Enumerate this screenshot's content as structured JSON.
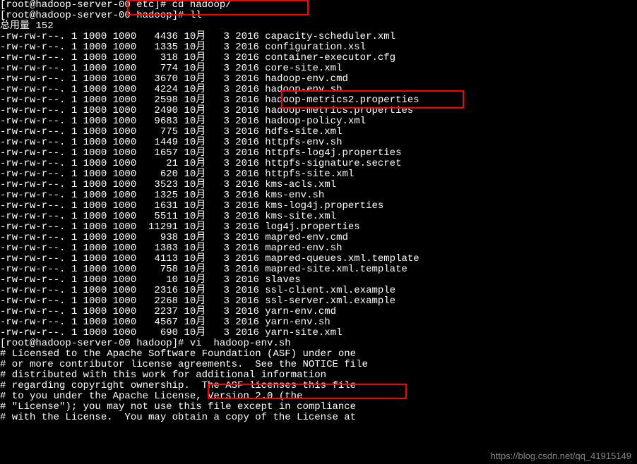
{
  "prompt1": "[root@hadoop-server-00 etc]# ",
  "cmd1": "cd hadoop/",
  "prompt2": "[root@hadoop-server-00 hadoop]# ",
  "cmd2": "ll",
  "total": "总用量 152",
  "files": [
    {
      "perm": "-rw-rw-r--.",
      "n": "1",
      "u": "1000",
      "g": "1000",
      "size": "  4436",
      "mon": "10月",
      "day": "  3",
      "year": "2016",
      "name": "capacity-scheduler.xml"
    },
    {
      "perm": "-rw-rw-r--.",
      "n": "1",
      "u": "1000",
      "g": "1000",
      "size": "  1335",
      "mon": "10月",
      "day": "  3",
      "year": "2016",
      "name": "configuration.xsl"
    },
    {
      "perm": "-rw-rw-r--.",
      "n": "1",
      "u": "1000",
      "g": "1000",
      "size": "   318",
      "mon": "10月",
      "day": "  3",
      "year": "2016",
      "name": "container-executor.cfg"
    },
    {
      "perm": "-rw-rw-r--.",
      "n": "1",
      "u": "1000",
      "g": "1000",
      "size": "   774",
      "mon": "10月",
      "day": "  3",
      "year": "2016",
      "name": "core-site.xml"
    },
    {
      "perm": "-rw-rw-r--.",
      "n": "1",
      "u": "1000",
      "g": "1000",
      "size": "  3670",
      "mon": "10月",
      "day": "  3",
      "year": "2016",
      "name": "hadoop-env.cmd"
    },
    {
      "perm": "-rw-rw-r--.",
      "n": "1",
      "u": "1000",
      "g": "1000",
      "size": "  4224",
      "mon": "10月",
      "day": "  3",
      "year": "2016",
      "name": "hadoop-env.sh"
    },
    {
      "perm": "-rw-rw-r--.",
      "n": "1",
      "u": "1000",
      "g": "1000",
      "size": "  2598",
      "mon": "10月",
      "day": "  3",
      "year": "2016",
      "name": "hadoop-metrics2.properties"
    },
    {
      "perm": "-rw-rw-r--.",
      "n": "1",
      "u": "1000",
      "g": "1000",
      "size": "  2490",
      "mon": "10月",
      "day": "  3",
      "year": "2016",
      "name": "hadoop-metrics.properties"
    },
    {
      "perm": "-rw-rw-r--.",
      "n": "1",
      "u": "1000",
      "g": "1000",
      "size": "  9683",
      "mon": "10月",
      "day": "  3",
      "year": "2016",
      "name": "hadoop-policy.xml"
    },
    {
      "perm": "-rw-rw-r--.",
      "n": "1",
      "u": "1000",
      "g": "1000",
      "size": "   775",
      "mon": "10月",
      "day": "  3",
      "year": "2016",
      "name": "hdfs-site.xml"
    },
    {
      "perm": "-rw-rw-r--.",
      "n": "1",
      "u": "1000",
      "g": "1000",
      "size": "  1449",
      "mon": "10月",
      "day": "  3",
      "year": "2016",
      "name": "httpfs-env.sh"
    },
    {
      "perm": "-rw-rw-r--.",
      "n": "1",
      "u": "1000",
      "g": "1000",
      "size": "  1657",
      "mon": "10月",
      "day": "  3",
      "year": "2016",
      "name": "httpfs-log4j.properties"
    },
    {
      "perm": "-rw-rw-r--.",
      "n": "1",
      "u": "1000",
      "g": "1000",
      "size": "    21",
      "mon": "10月",
      "day": "  3",
      "year": "2016",
      "name": "httpfs-signature.secret"
    },
    {
      "perm": "-rw-rw-r--.",
      "n": "1",
      "u": "1000",
      "g": "1000",
      "size": "   620",
      "mon": "10月",
      "day": "  3",
      "year": "2016",
      "name": "httpfs-site.xml"
    },
    {
      "perm": "-rw-rw-r--.",
      "n": "1",
      "u": "1000",
      "g": "1000",
      "size": "  3523",
      "mon": "10月",
      "day": "  3",
      "year": "2016",
      "name": "kms-acls.xml"
    },
    {
      "perm": "-rw-rw-r--.",
      "n": "1",
      "u": "1000",
      "g": "1000",
      "size": "  1325",
      "mon": "10月",
      "day": "  3",
      "year": "2016",
      "name": "kms-env.sh"
    },
    {
      "perm": "-rw-rw-r--.",
      "n": "1",
      "u": "1000",
      "g": "1000",
      "size": "  1631",
      "mon": "10月",
      "day": "  3",
      "year": "2016",
      "name": "kms-log4j.properties"
    },
    {
      "perm": "-rw-rw-r--.",
      "n": "1",
      "u": "1000",
      "g": "1000",
      "size": "  5511",
      "mon": "10月",
      "day": "  3",
      "year": "2016",
      "name": "kms-site.xml"
    },
    {
      "perm": "-rw-rw-r--.",
      "n": "1",
      "u": "1000",
      "g": "1000",
      "size": " 11291",
      "mon": "10月",
      "day": "  3",
      "year": "2016",
      "name": "log4j.properties"
    },
    {
      "perm": "-rw-rw-r--.",
      "n": "1",
      "u": "1000",
      "g": "1000",
      "size": "   938",
      "mon": "10月",
      "day": "  3",
      "year": "2016",
      "name": "mapred-env.cmd"
    },
    {
      "perm": "-rw-rw-r--.",
      "n": "1",
      "u": "1000",
      "g": "1000",
      "size": "  1383",
      "mon": "10月",
      "day": "  3",
      "year": "2016",
      "name": "mapred-env.sh"
    },
    {
      "perm": "-rw-rw-r--.",
      "n": "1",
      "u": "1000",
      "g": "1000",
      "size": "  4113",
      "mon": "10月",
      "day": "  3",
      "year": "2016",
      "name": "mapred-queues.xml.template"
    },
    {
      "perm": "-rw-rw-r--.",
      "n": "1",
      "u": "1000",
      "g": "1000",
      "size": "   758",
      "mon": "10月",
      "day": "  3",
      "year": "2016",
      "name": "mapred-site.xml.template"
    },
    {
      "perm": "-rw-rw-r--.",
      "n": "1",
      "u": "1000",
      "g": "1000",
      "size": "    10",
      "mon": "10月",
      "day": "  3",
      "year": "2016",
      "name": "slaves"
    },
    {
      "perm": "-rw-rw-r--.",
      "n": "1",
      "u": "1000",
      "g": "1000",
      "size": "  2316",
      "mon": "10月",
      "day": "  3",
      "year": "2016",
      "name": "ssl-client.xml.example"
    },
    {
      "perm": "-rw-rw-r--.",
      "n": "1",
      "u": "1000",
      "g": "1000",
      "size": "  2268",
      "mon": "10月",
      "day": "  3",
      "year": "2016",
      "name": "ssl-server.xml.example"
    },
    {
      "perm": "-rw-rw-r--.",
      "n": "1",
      "u": "1000",
      "g": "1000",
      "size": "  2237",
      "mon": "10月",
      "day": "  3",
      "year": "2016",
      "name": "yarn-env.cmd"
    },
    {
      "perm": "-rw-rw-r--.",
      "n": "1",
      "u": "1000",
      "g": "1000",
      "size": "  4567",
      "mon": "10月",
      "day": "  3",
      "year": "2016",
      "name": "yarn-env.sh"
    },
    {
      "perm": "-rw-rw-r--.",
      "n": "1",
      "u": "1000",
      "g": "1000",
      "size": "   690",
      "mon": "10月",
      "day": "  3",
      "year": "2016",
      "name": "yarn-site.xml"
    }
  ],
  "prompt3": "[root@hadoop-server-00 hadoop]# ",
  "cmd3": "vi  hadoop-env.sh",
  "license": [
    "# Licensed to the Apache Software Foundation (ASF) under one",
    "# or more contributor license agreements.  See the NOTICE file",
    "# distributed with this work for additional information",
    "# regarding copyright ownership.  The ASF licenses this file",
    "# to you under the Apache License, Version 2.0 (the",
    "# \"License\"); you may not use this file except in compliance",
    "# with the License.  You may obtain a copy of the License at"
  ],
  "watermark": "https://blog.csdn.net/qq_41915149"
}
